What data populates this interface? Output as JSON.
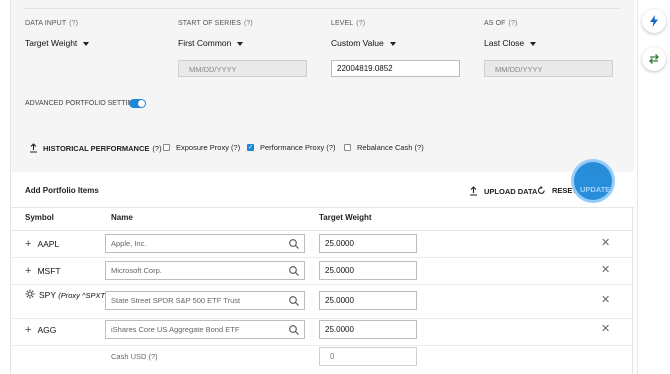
{
  "settings": {
    "data_input": {
      "label": "DATA INPUT",
      "help": "(?)",
      "value": "Target Weight"
    },
    "start_of_series": {
      "label": "START OF SERIES",
      "help": "(?)",
      "value": "First Common",
      "date_placeholder": "MM/DD/YYYY"
    },
    "level": {
      "label": "LEVEL",
      "help": "(?)",
      "value": "Custom Value",
      "input_value": "22004819.0852"
    },
    "as_of": {
      "label": "AS OF",
      "help": "(?)",
      "value": "Last Close",
      "date_placeholder": "MM/DD/YYYY"
    },
    "advanced_label": "ADVANCED PORTFOLIO SETTINGS",
    "advanced_enabled": true,
    "historical_performance": {
      "label": "HISTORICAL PERFORMANCE",
      "help": "(?)"
    },
    "checkboxes": [
      {
        "label": "Exposure Proxy (?)",
        "checked": false
      },
      {
        "label": "Performance Proxy (?)",
        "checked": true
      },
      {
        "label": "Rebalance Cash (?)",
        "checked": false
      }
    ]
  },
  "items": {
    "title": "Add Portfolio Items",
    "upload_label": "UPLOAD DATA",
    "reset_label": "RESET",
    "update_label": "UPDATE",
    "columns": {
      "symbol": "Symbol",
      "name": "Name",
      "weight": "Target Weight"
    },
    "rows": [
      {
        "symbol": "AAPL",
        "proxy": "",
        "name": "Apple, Inc.",
        "weight": "25.0000",
        "icon": "plus-icon"
      },
      {
        "symbol": "MSFT",
        "proxy": "",
        "name": "Microsoft Corp.",
        "weight": "25.0000",
        "icon": "plus-icon"
      },
      {
        "symbol": "SPY",
        "proxy": "(Proxy ^SPXTR)",
        "name": "State Street SPDR S&P 500 ETF Trust",
        "weight": "25.0000",
        "icon": "gear-icon"
      },
      {
        "symbol": "AGG",
        "proxy": "",
        "name": "iShares Core US Aggregate Bond ETF",
        "weight": "25.0000",
        "icon": "plus-icon"
      }
    ],
    "cash": {
      "label": "Cash USD (?)",
      "value": "0"
    }
  },
  "colors": {
    "accent": "#1e88d8",
    "rail_bolt": "#1565c0",
    "rail_swap": "#2e7d32"
  }
}
